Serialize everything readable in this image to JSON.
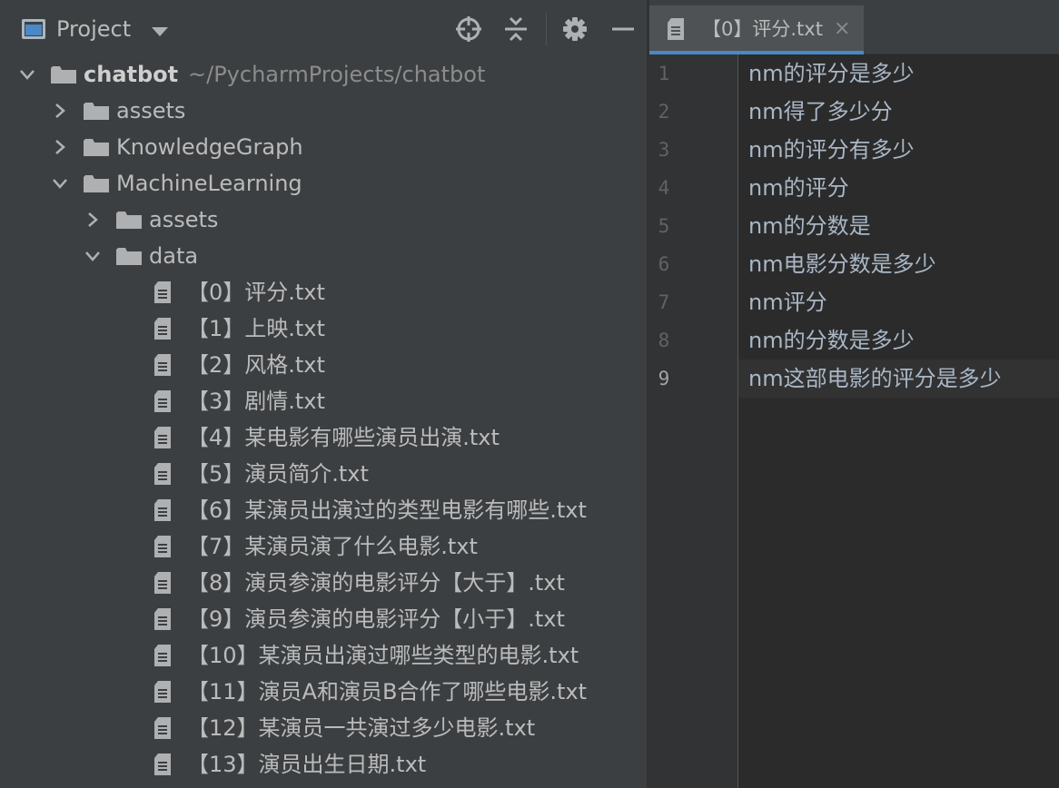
{
  "project_panel": {
    "title": "Project",
    "toolbar_icons": [
      "locate-icon",
      "collapse-all-icon",
      "gear-icon",
      "minimize-icon"
    ],
    "tree": [
      {
        "label": "chatbot",
        "path": "~/PycharmProjects/chatbot",
        "type": "folder",
        "level": 0,
        "expanded": true
      },
      {
        "label": "assets",
        "type": "folder",
        "level": 1,
        "expanded": false
      },
      {
        "label": "KnowledgeGraph",
        "type": "folder",
        "level": 1,
        "expanded": false
      },
      {
        "label": "MachineLearning",
        "type": "folder",
        "level": 1,
        "expanded": true
      },
      {
        "label": "assets",
        "type": "folder",
        "level": 2,
        "expanded": false
      },
      {
        "label": "data",
        "type": "folder",
        "level": 2,
        "expanded": true
      },
      {
        "label": "【0】评分.txt",
        "type": "file",
        "level": 3
      },
      {
        "label": "【1】上映.txt",
        "type": "file",
        "level": 3
      },
      {
        "label": "【2】风格.txt",
        "type": "file",
        "level": 3
      },
      {
        "label": "【3】剧情.txt",
        "type": "file",
        "level": 3
      },
      {
        "label": "【4】某电影有哪些演员出演.txt",
        "type": "file",
        "level": 3
      },
      {
        "label": "【5】演员简介.txt",
        "type": "file",
        "level": 3
      },
      {
        "label": "【6】某演员出演过的类型电影有哪些.txt",
        "type": "file",
        "level": 3
      },
      {
        "label": "【7】某演员演了什么电影.txt",
        "type": "file",
        "level": 3
      },
      {
        "label": "【8】演员参演的电影评分【大于】.txt",
        "type": "file",
        "level": 3
      },
      {
        "label": "【9】演员参演的电影评分【小于】.txt",
        "type": "file",
        "level": 3
      },
      {
        "label": "【10】某演员出演过哪些类型的电影.txt",
        "type": "file",
        "level": 3
      },
      {
        "label": "【11】演员A和演员B合作了哪些电影.txt",
        "type": "file",
        "level": 3
      },
      {
        "label": "【12】某演员一共演过多少电影.txt",
        "type": "file",
        "level": 3
      },
      {
        "label": "【13】演员出生日期.txt",
        "type": "file",
        "level": 3
      }
    ]
  },
  "editor": {
    "tab": {
      "label": "【0】评分.txt",
      "close": "×"
    },
    "current_line": 9,
    "lines": [
      {
        "number": "1",
        "text": "nm的评分是多少"
      },
      {
        "number": "2",
        "text": "nm得了多少分"
      },
      {
        "number": "3",
        "text": "nm的评分有多少"
      },
      {
        "number": "4",
        "text": "nm的评分"
      },
      {
        "number": "5",
        "text": "nm的分数是"
      },
      {
        "number": "6",
        "text": "nm电影分数是多少"
      },
      {
        "number": "7",
        "text": "nm评分"
      },
      {
        "number": "8",
        "text": "nm的分数是多少"
      },
      {
        "number": "9",
        "text": "nm这部电影的评分是多少"
      }
    ]
  },
  "colors": {
    "panel_bg": "#3c3f41",
    "editor_bg": "#2b2b2b",
    "gutter_bg": "#313335",
    "accent": "#4a88c7",
    "text": "#bbbbbb",
    "folder_icon": "#aeb0b2"
  }
}
